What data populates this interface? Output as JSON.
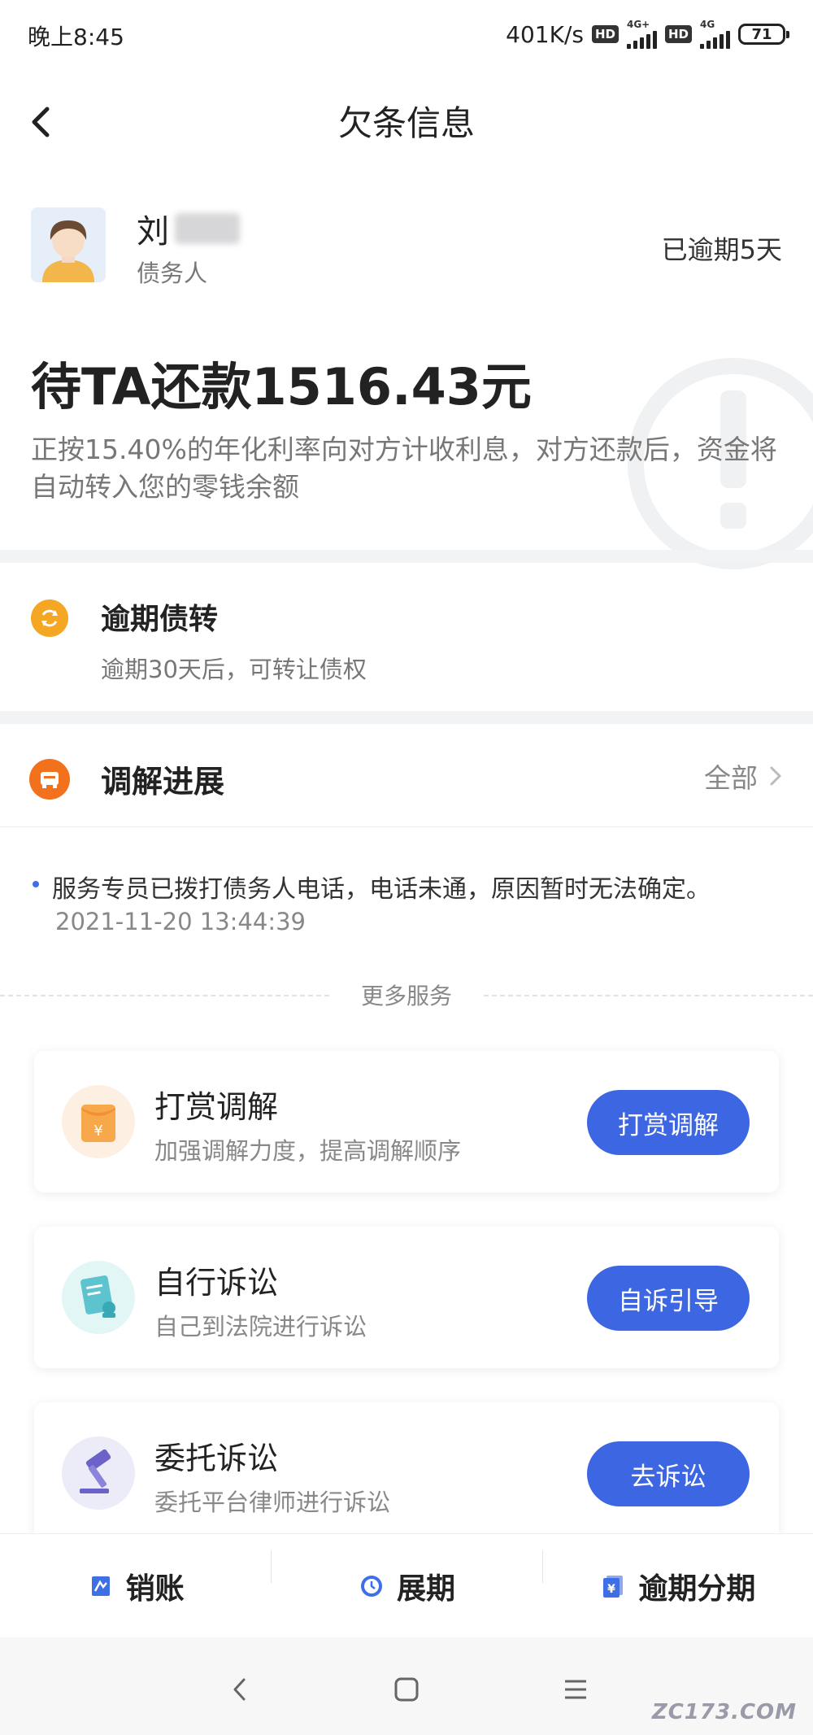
{
  "status_bar": {
    "time": "晚上8:45",
    "network_speed": "401K/s",
    "hd_label": "HD",
    "net_type_1": "4G+",
    "net_type_2": "4G",
    "battery": "71"
  },
  "header": {
    "title": "欠条信息"
  },
  "debtor": {
    "name_visible": "刘",
    "role": "债务人",
    "overdue_status": "已逾期5天"
  },
  "amount": {
    "title": "待TA还款1516.43元",
    "description": "正按15.40%的年化利率向对方计收利息，对方还款后，资金将自动转入您的零钱余额"
  },
  "debt_transfer": {
    "title": "逾期债转",
    "description": "逾期30天后，可转让债权"
  },
  "mediation": {
    "title": "调解进展",
    "all_label": "全部",
    "record_text": "服务专员已拨打债务人电话，电话未通，原因暂时无法确定。",
    "record_time": "2021-11-20 13:44:39"
  },
  "more_services": {
    "label": "更多服务",
    "items": [
      {
        "title": "打赏调解",
        "desc": "加强调解力度，提高调解顺序",
        "button": "打赏调解",
        "icon": "reward-envelope-icon"
      },
      {
        "title": "自行诉讼",
        "desc": "自己到法院进行诉讼",
        "button": "自诉引导",
        "icon": "document-stamp-icon"
      },
      {
        "title": "委托诉讼",
        "desc": "委托平台律师进行诉讼",
        "button": "去诉讼",
        "icon": "gavel-icon"
      }
    ]
  },
  "bottom_actions": [
    {
      "label": "销账",
      "icon": "write-off-icon"
    },
    {
      "label": "展期",
      "icon": "extension-clock-icon"
    },
    {
      "label": "逾期分期",
      "icon": "installment-icon"
    }
  ],
  "watermark": "ZC173.COM",
  "colors": {
    "primary_button": "#3d66e2",
    "transfer_icon": "#f5a623",
    "mediation_icon": "#f2711c",
    "action_icon": "#3f6fe5"
  }
}
